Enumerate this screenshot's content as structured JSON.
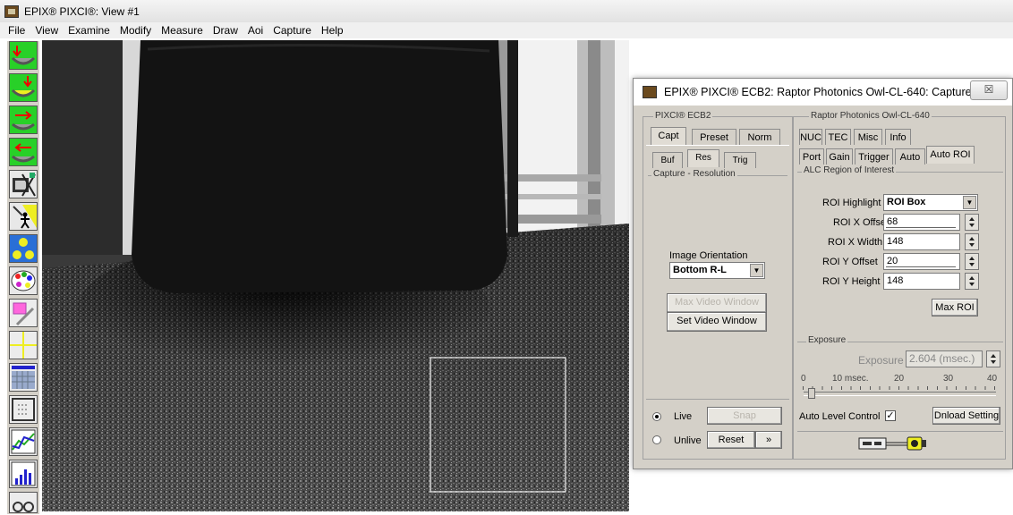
{
  "window": {
    "title": "EPIX® PIXCI®: View #1"
  },
  "menu": [
    "File",
    "View",
    "Examine",
    "Modify",
    "Measure",
    "Draw",
    "Aoi",
    "Capture",
    "Help"
  ],
  "toolbar_icons": [
    "capture-down-icon",
    "capture-down-yellow-icon",
    "capture-right-icon",
    "capture-left-icon",
    "monitor-cross-icon",
    "walker-icon",
    "face-grid-icon",
    "palette-icon",
    "pencil-roi-icon",
    "crosshair-icon",
    "blue-grid-icon",
    "grid-icon",
    "line-plot-icon",
    "histogram-icon",
    "more-icon"
  ],
  "dialog": {
    "title": "EPIX® PIXCI® ECB2: Raptor Photonics Owl-CL-640: Capture ...",
    "close_label": "☒",
    "left_group": "PIXCI® ECB2",
    "left_tabs": [
      "Capt",
      "Preset",
      "Norm"
    ],
    "left_subtabs": [
      "Buf",
      "Res",
      "Trig"
    ],
    "capture_resolution_label": "Capture - Resolution",
    "image_orientation_label": "Image Orientation",
    "image_orientation_value": "Bottom R-L",
    "max_video_window": "Max Video Window",
    "set_video_window": "Set Video Window",
    "live_label": "Live",
    "unlive_label": "Unlive",
    "snap_label": "Snap",
    "reset_label": "Reset",
    "more_label": "»",
    "right_group": "Raptor Photonics Owl-CL-640",
    "right_tabs_row1": [
      "NUC",
      "TEC",
      "Misc",
      "Info"
    ],
    "right_tabs_row2": [
      "Port",
      "Gain",
      "Trigger",
      "Auto",
      "Auto ROI"
    ],
    "alc_label": "ALC Region of Interest",
    "roi_highlight_label": "ROI Highlight",
    "roi_highlight_value": "ROI Box",
    "roi_x_offset_label": "ROI X Offset",
    "roi_x_offset_value": "68",
    "roi_x_width_label": "ROI X Width",
    "roi_x_width_value": "148",
    "roi_y_offset_label": "ROI Y Offset",
    "roi_y_offset_value": "20",
    "roi_y_height_label": "ROI Y Height",
    "roi_y_height_value": "148",
    "max_roi": "Max ROI",
    "exposure_group": "Exposure",
    "exposure_label": "Exposure",
    "exposure_value": "2.604 (msec.)",
    "slider_ticks": [
      "0",
      "10 msec.",
      "20",
      "30",
      "40"
    ],
    "auto_level_label": "Auto Level Control",
    "auto_level_check": "✓",
    "dnload_setting": "Dnload Setting"
  }
}
